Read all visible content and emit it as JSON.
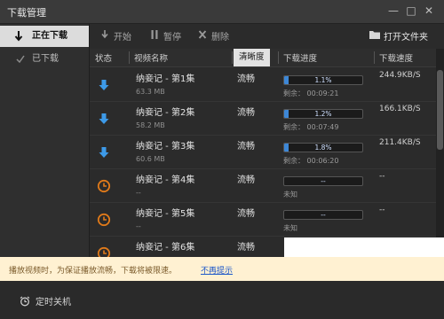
{
  "window": {
    "title": "下载管理",
    "controls": [
      "—",
      "□",
      "✕"
    ]
  },
  "sidebar": {
    "items": [
      {
        "label": "正在下载",
        "active": true,
        "icon": "download-arrow-icon"
      },
      {
        "label": "已下载",
        "active": false,
        "icon": "check-icon"
      }
    ]
  },
  "toolbar": {
    "start_label": "开始",
    "pause_label": "暂停",
    "delete_label": "删除",
    "open_folder_label": "打开文件夹"
  },
  "columns": {
    "state": "状态",
    "name": "视频名称",
    "quality": "清晰度",
    "progress": "下载进度",
    "speed": "下载速度"
  },
  "rows": [
    {
      "state": "downloading",
      "name": "纳妾记 - 第1集",
      "size": "63.3 MB",
      "quality": "流畅",
      "progress_text": "1.1%",
      "progress": 0.011,
      "remain": "剩余：  00:09:21",
      "speed": "244.9KB/S"
    },
    {
      "state": "downloading",
      "name": "纳妾记 - 第2集",
      "size": "58.2 MB",
      "quality": "流畅",
      "progress_text": "1.2%",
      "progress": 0.012,
      "remain": "剩余：  00:07:49",
      "speed": "166.1KB/S"
    },
    {
      "state": "downloading",
      "name": "纳妾记 - 第3集",
      "size": "60.6 MB",
      "quality": "流畅",
      "progress_text": "1.8%",
      "progress": 0.018,
      "remain": "剩余：  00:06:20",
      "speed": "211.4KB/S"
    },
    {
      "state": "waiting",
      "name": "纳妾记 - 第4集",
      "size": "--",
      "quality": "流畅",
      "progress_text": "--",
      "progress": 0,
      "remain": "未知",
      "speed": "--"
    },
    {
      "state": "waiting",
      "name": "纳妾记 - 第5集",
      "size": "--",
      "quality": "流畅",
      "progress_text": "--",
      "progress": 0,
      "remain": "未知",
      "speed": "--"
    },
    {
      "state": "waiting",
      "name": "纳妾记 - 第6集",
      "size": "",
      "quality": "流畅",
      "progress_text": "",
      "progress": 0,
      "remain": "",
      "speed": ""
    }
  ],
  "notice": {
    "message": "播放视频时，为保证播放流畅，下载将被限速。",
    "link": "不再提示"
  },
  "footer": {
    "timer_label": "定时关机"
  },
  "colors": {
    "accent": "#3d87d6",
    "waiting": "#e07a1a",
    "notice_bg": "#fff1d2",
    "link": "#1a55c9"
  }
}
